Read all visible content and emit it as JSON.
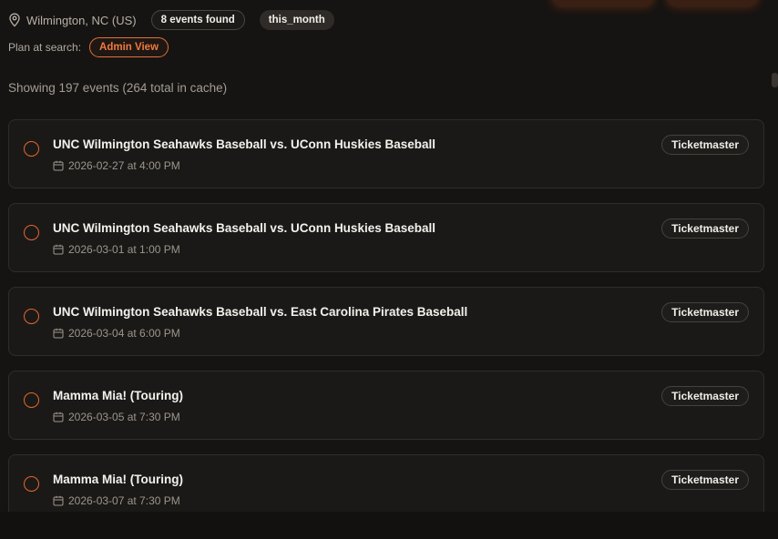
{
  "header": {
    "location": "Wilmington, NC (US)",
    "events_found": "8 events found",
    "period": "this_month",
    "plan_label": "Plan at search:",
    "plan_value": "Admin View"
  },
  "summary": "Showing 197 events (264 total in cache)",
  "events": [
    {
      "title": "UNC Wilmington Seahawks Baseball vs. UConn Huskies Baseball",
      "date": "2026-02-27 at 4:00 PM",
      "source": "Ticketmaster"
    },
    {
      "title": "UNC Wilmington Seahawks Baseball vs. UConn Huskies Baseball",
      "date": "2026-03-01 at 1:00 PM",
      "source": "Ticketmaster"
    },
    {
      "title": "UNC Wilmington Seahawks Baseball vs. East Carolina Pirates Baseball",
      "date": "2026-03-04 at 6:00 PM",
      "source": "Ticketmaster"
    },
    {
      "title": "Mamma Mia! (Touring)",
      "date": "2026-03-05 at 7:30 PM",
      "source": "Ticketmaster"
    },
    {
      "title": "Mamma Mia! (Touring)",
      "date": "2026-03-07 at 7:30 PM",
      "source": "Ticketmaster"
    }
  ],
  "colors": {
    "accent": "#e2682c",
    "background": "#161412",
    "card": "#1b1917"
  },
  "icons": {
    "location": "map-pin-icon",
    "date": "calendar-icon",
    "select": "radio-circle-icon"
  }
}
